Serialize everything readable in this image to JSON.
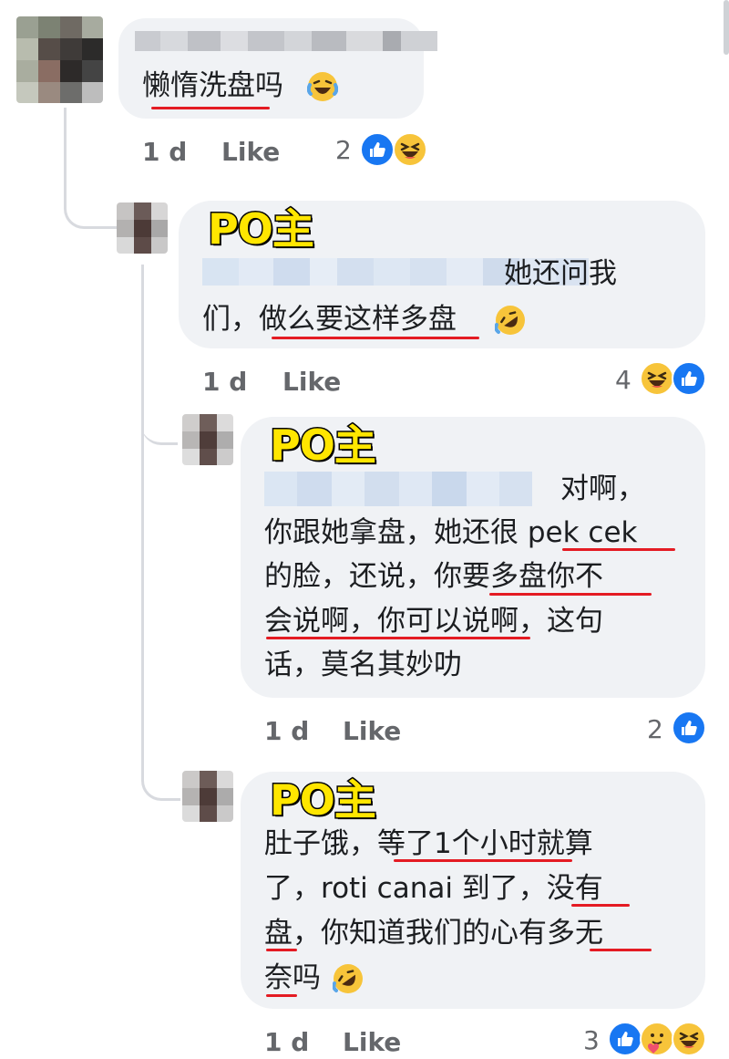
{
  "comments": [
    {
      "id": "c1",
      "lines": [
        "懒惰洗盘吗"
      ],
      "time": "1 d",
      "like_label": "Like",
      "reaction_count": "2",
      "reactions": [
        "like-icon",
        "haha-icon"
      ]
    },
    {
      "id": "c2",
      "tag": "PO主",
      "lines": [
        "她还问我",
        "们，做么要这样多盘"
      ],
      "time": "1 d",
      "like_label": "Like",
      "reaction_count": "4",
      "reactions": [
        "haha-icon",
        "like-icon"
      ]
    },
    {
      "id": "c3",
      "tag": "PO主",
      "lines": [
        "对啊，",
        "你跟她拿盘，她还很 pek cek",
        "的脸，还说，你要多盘你不",
        "会说啊，你可以说啊，这句",
        "话，莫名其妙叻"
      ],
      "time": "1 d",
      "like_label": "Like",
      "reaction_count": "2",
      "reactions": [
        "like-icon"
      ]
    },
    {
      "id": "c4",
      "tag": "PO主",
      "lines": [
        "肚子饿，等了1个小时就算",
        "了，roti canai 到了，没有",
        "盘，你知道我们的心有多无",
        "奈吗"
      ],
      "time": "1 d",
      "like_label": "Like",
      "reaction_count": "3",
      "reactions": [
        "like-icon",
        "care-icon",
        "haha-icon"
      ]
    }
  ],
  "colors": {
    "bubble": "#f0f2f5",
    "underline": "#e41b23",
    "tag_fill": "#ffe600",
    "like_blue": "#1877f2",
    "meta": "#65676b"
  }
}
